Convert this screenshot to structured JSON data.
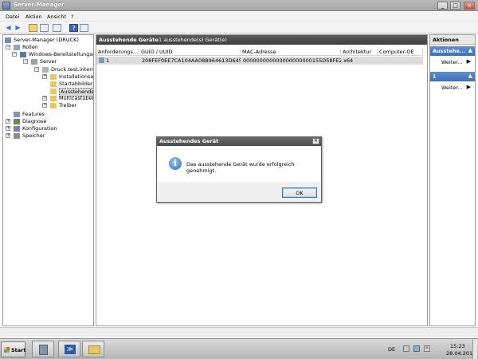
{
  "window": {
    "title": "Server-Manager"
  },
  "menu": [
    "Datei",
    "Aktion",
    "Ansicht",
    "?"
  ],
  "tree": {
    "items": [
      {
        "label": "Server-Manager (DRUCK)"
      },
      {
        "label": "Rollen"
      },
      {
        "label": "Windows-Bereitstellungsdie"
      },
      {
        "label": "Server"
      },
      {
        "label": "Druck.test.intern"
      },
      {
        "label": "Installationsabb"
      },
      {
        "label": "Startabbilder"
      },
      {
        "label": "Ausstehende G"
      },
      {
        "label": "Multicastübertr"
      },
      {
        "label": "Treiber"
      },
      {
        "label": "Features"
      },
      {
        "label": "Diagnose"
      },
      {
        "label": "Konfiguration"
      },
      {
        "label": "Speicher"
      }
    ]
  },
  "center": {
    "title": "Ausstehende Geräte",
    "subtitle": "1 ausstehende(s) Gerät(e)",
    "columns": [
      "Anforderungs...",
      "GUID / UUID",
      "MAC-Adresse",
      "Architektur",
      "Computer-OE"
    ],
    "rows": [
      [
        "1",
        "208FEF0EE7CA104AA08B964613D645AC",
        "000000000000000000000155D58FE2A",
        "x64",
        ""
      ]
    ]
  },
  "actions": {
    "header": "Aktionen",
    "sections": [
      {
        "label": "Ausstehe...",
        "item": "Weiter..."
      },
      {
        "label": "1",
        "item": "Weiter..."
      }
    ]
  },
  "dialog": {
    "title": "Ausstehendes Gerät",
    "message": "Das ausstehende Gerät wurde erfolgreich genehmigt.",
    "ok_label": "OK",
    "icon": "info-icon"
  },
  "taskbar": {
    "start_label": "Start",
    "lang": "DE",
    "time": "15:23",
    "date": "28.04.2011"
  }
}
